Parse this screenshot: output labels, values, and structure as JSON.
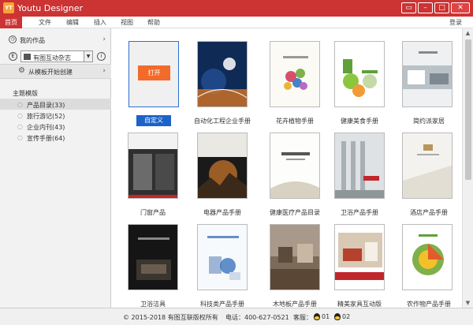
{
  "window": {
    "logo": "YT",
    "title": "Youtu Designer",
    "buttons": [
      "▭",
      "–",
      "□",
      "✕"
    ]
  },
  "menu": {
    "items": [
      "首页",
      "文件",
      "编辑",
      "插入",
      "视图",
      "帮助"
    ],
    "login": "登录"
  },
  "sidebar": {
    "my_works": "我的作品",
    "magazine_select": "有图互动杂志",
    "create_from_template": "从模板开始创建",
    "section_title": "主题模版",
    "templates": [
      {
        "label": "产品目录(33)"
      },
      {
        "label": "旅行游记(52)"
      },
      {
        "label": "企业内刊(43)"
      },
      {
        "label": "宣传手册(64)"
      }
    ]
  },
  "content": {
    "custom": {
      "open_label": "打开",
      "caption": "自定义"
    },
    "cards": [
      "自动化工程企业手册",
      "花卉植物手册",
      "健康美食手册",
      "简约派家居",
      "门窗产品",
      "电器产品手册",
      "健康医疗产品目录",
      "卫浴产品手册",
      "酒店产品手册",
      "卫浴洁具",
      "科技类产品手册",
      "木地板产品手册",
      "精美家具互动版",
      "农作物产品手册"
    ]
  },
  "footer": {
    "copyright": "© 2015-2018 有图互联版权所有",
    "phone": "电话：400-627-0521",
    "service": "客服：",
    "qq1": "01",
    "qq2": "02"
  },
  "colors": {
    "brand": "#cc3333",
    "accent": "#1d62c9",
    "open_button": "#f26b2b"
  }
}
